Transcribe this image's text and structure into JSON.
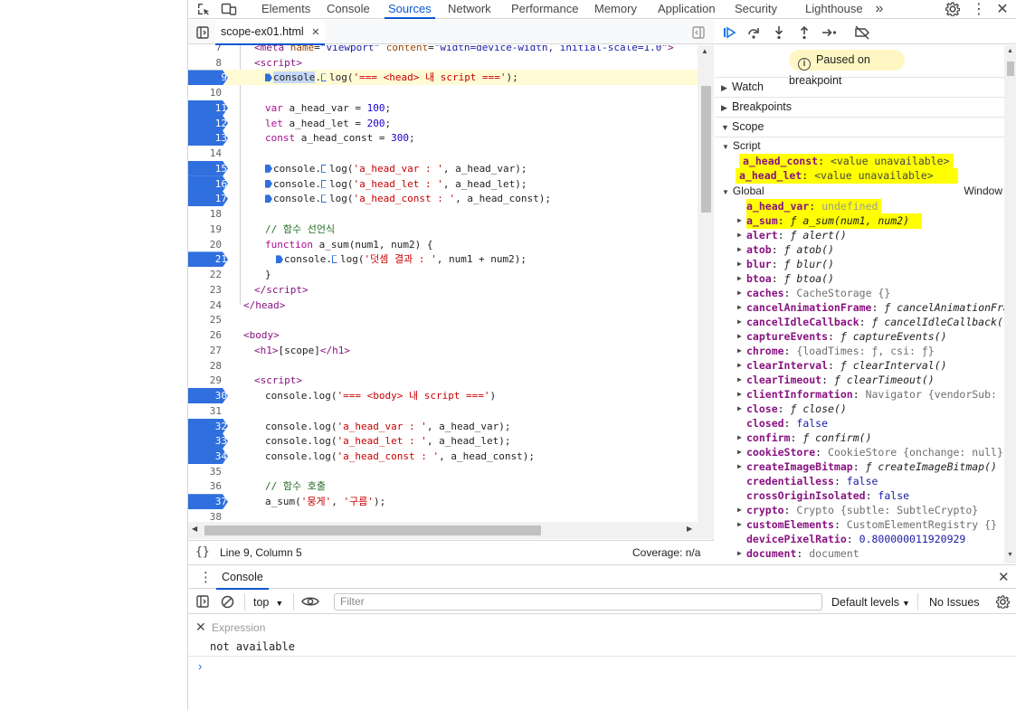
{
  "top_tabs": [
    "Elements",
    "Console",
    "Sources",
    "Network",
    "Performance",
    "Memory",
    "Application",
    "Security",
    "Lighthouse"
  ],
  "active_tab": "Sources",
  "file_tab": {
    "name": "scope-ex01.html"
  },
  "status": {
    "position": "Line 9, Column 5",
    "coverage": "Coverage: n/a"
  },
  "paused_text": "Paused on breakpoint",
  "sections": {
    "watch": "Watch",
    "breakpoints": "Breakpoints",
    "scope": "Scope",
    "script": "Script",
    "global": "Global",
    "global_value": "Window"
  },
  "scope_script": [
    {
      "name": "a_head_const",
      "value": "<value unavailable>"
    },
    {
      "name": "a_head_let",
      "value": "<value unavailable>"
    }
  ],
  "scope_global": [
    {
      "name": "a_head_var",
      "value": "undefined",
      "kind": "plain",
      "hl": true,
      "exp": false
    },
    {
      "name": "a_sum",
      "value": "ƒ a_sum(num1, num2)",
      "kind": "fn",
      "hl": true,
      "exp": true
    },
    {
      "name": "alert",
      "value": "ƒ alert()",
      "kind": "fn",
      "exp": true
    },
    {
      "name": "atob",
      "value": "ƒ atob()",
      "kind": "fn",
      "exp": true
    },
    {
      "name": "blur",
      "value": "ƒ blur()",
      "kind": "fn",
      "exp": true
    },
    {
      "name": "btoa",
      "value": "ƒ btoa()",
      "kind": "fn",
      "exp": true
    },
    {
      "name": "caches",
      "value": "CacheStorage {}",
      "kind": "plain",
      "exp": true
    },
    {
      "name": "cancelAnimationFrame",
      "value": "ƒ cancelAnimationFrame(",
      "kind": "fn",
      "exp": true
    },
    {
      "name": "cancelIdleCallback",
      "value": "ƒ cancelIdleCallback(",
      "kind": "fn",
      "exp": true
    },
    {
      "name": "captureEvents",
      "value": "ƒ captureEvents()",
      "kind": "fn",
      "exp": true
    },
    {
      "name": "chrome",
      "value": "{loadTimes: ƒ, csi: ƒ}",
      "kind": "plain",
      "exp": true
    },
    {
      "name": "clearInterval",
      "value": "ƒ clearInterval()",
      "kind": "fn",
      "exp": true
    },
    {
      "name": "clearTimeout",
      "value": "ƒ clearTimeout()",
      "kind": "fn",
      "exp": true
    },
    {
      "name": "clientInformation",
      "value": "Navigator {vendorSub: '', p",
      "kind": "plain",
      "exp": true
    },
    {
      "name": "close",
      "value": "ƒ close()",
      "kind": "fn",
      "exp": true
    },
    {
      "name": "closed",
      "value": "false",
      "kind": "bool",
      "exp": false
    },
    {
      "name": "confirm",
      "value": "ƒ confirm()",
      "kind": "fn",
      "exp": true
    },
    {
      "name": "cookieStore",
      "value": "CookieStore {onchange: null}",
      "kind": "plain",
      "exp": true
    },
    {
      "name": "createImageBitmap",
      "value": "ƒ createImageBitmap()",
      "kind": "fn",
      "exp": true
    },
    {
      "name": "credentialless",
      "value": "false",
      "kind": "bool",
      "exp": false
    },
    {
      "name": "crossOriginIsolated",
      "value": "false",
      "kind": "bool",
      "exp": false
    },
    {
      "name": "crypto",
      "value": "Crypto {subtle: SubtleCrypto}",
      "kind": "plain",
      "exp": true
    },
    {
      "name": "customElements",
      "value": "CustomElementRegistry {}",
      "kind": "plain",
      "exp": true
    },
    {
      "name": "devicePixelRatio",
      "value": "0.800000011920929",
      "kind": "bool",
      "exp": false
    },
    {
      "name": "document",
      "value": "document",
      "kind": "plain",
      "exp": true
    }
  ],
  "code_lines": [
    {
      "n": 7,
      "html": "<span class=\"tag\">&lt;meta</span> <span class=\"attr\">name</span>=<span class=\"aval\">\"viewport\"</span> <span class=\"attr\">content</span>=<span class=\"aval\">\"width=device-width, initial-scale=1.0\"</span><span class=\"tag\">&gt;</span>",
      "indent": 1
    },
    {
      "n": 8,
      "html": "<span class=\"tag\">&lt;script&gt;</span>",
      "indent": 1
    },
    {
      "n": 9,
      "bp": true,
      "hl": true,
      "html": "<span class=\"bpm\"></span><span class=\"sel\">console</span>.<span class=\"bpo\"></span>log(<span class=\"str\">'=== &lt;head&gt; 내 script ==='</span>);",
      "indent": 2
    },
    {
      "n": 10,
      "html": "",
      "indent": 2
    },
    {
      "n": 11,
      "bp": true,
      "html": "<span class=\"kw\">var</span> a_head_var = <span class=\"num\">100</span>;",
      "indent": 2
    },
    {
      "n": 12,
      "bp": true,
      "html": "<span class=\"kw\">let</span> a_head_let = <span class=\"num\">200</span>;",
      "indent": 2
    },
    {
      "n": 13,
      "bp": true,
      "html": "<span class=\"kw\">const</span> a_head_const = <span class=\"num\">300</span>;",
      "indent": 2
    },
    {
      "n": 14,
      "html": "",
      "indent": 2
    },
    {
      "n": 15,
      "bp": true,
      "html": "<span class=\"bpm\"></span>console.<span class=\"bpo\"></span>log(<span class=\"str\">'a_head_var : '</span>, a_head_var);",
      "indent": 2
    },
    {
      "n": 16,
      "bp": true,
      "html": "<span class=\"bpm\"></span>console.<span class=\"bpo\"></span>log(<span class=\"str\">'a_head_let : '</span>, a_head_let);",
      "indent": 2
    },
    {
      "n": 17,
      "bp": true,
      "html": "<span class=\"bpm\"></span>console.<span class=\"bpo\"></span>log(<span class=\"str\">'a_head_const : '</span>, a_head_const);",
      "indent": 2
    },
    {
      "n": 18,
      "html": "",
      "indent": 2
    },
    {
      "n": 19,
      "html": "<span class=\"cm\">// 함수 선언식</span>",
      "indent": 2
    },
    {
      "n": 20,
      "html": "<span class=\"kw\">function</span> a_sum(num1, num2) {",
      "indent": 2
    },
    {
      "n": 21,
      "bp": true,
      "html": "<span class=\"bpm\"></span>console.<span class=\"bpo\"></span>log(<span class=\"str\">'덧셈 결과 : '</span>, num1 + num2);",
      "indent": 3
    },
    {
      "n": 22,
      "html": "}",
      "indent": 2
    },
    {
      "n": 23,
      "html": "<span class=\"tag\">&lt;/script&gt;</span>",
      "indent": 1
    },
    {
      "n": 24,
      "html": "<span class=\"tag\">&lt;/head&gt;</span>",
      "indent": 0
    },
    {
      "n": 25,
      "html": "",
      "indent": 0
    },
    {
      "n": 26,
      "html": "<span class=\"tag\">&lt;body&gt;</span>",
      "indent": 0
    },
    {
      "n": 27,
      "html": "<span class=\"tag\">&lt;h1&gt;</span>[scope]<span class=\"tag\">&lt;/h1&gt;</span>",
      "indent": 1
    },
    {
      "n": 28,
      "html": "",
      "indent": 1
    },
    {
      "n": 29,
      "html": "<span class=\"tag\">&lt;script&gt;</span>",
      "indent": 1
    },
    {
      "n": 30,
      "bp": true,
      "html": "console.log(<span class=\"str\">'=== &lt;body&gt; 내 script ==='</span>)",
      "indent": 2
    },
    {
      "n": 31,
      "html": "",
      "indent": 2
    },
    {
      "n": 32,
      "bp": true,
      "html": "console.log(<span class=\"str\">'a_head_var : '</span>, a_head_var);",
      "indent": 2
    },
    {
      "n": 33,
      "bp": true,
      "html": "console.log(<span class=\"str\">'a_head_let : '</span>, a_head_let);",
      "indent": 2
    },
    {
      "n": 34,
      "bp": true,
      "html": "console.log(<span class=\"str\">'a_head_const : '</span>, a_head_const);",
      "indent": 2
    },
    {
      "n": 35,
      "html": "",
      "indent": 2
    },
    {
      "n": 36,
      "html": "<span class=\"cm\">// 함수 호출</span>",
      "indent": 2
    },
    {
      "n": 37,
      "bp": true,
      "html": "a_sum(<span class=\"str\">'뭉게'</span>, <span class=\"str\">'구름'</span>);",
      "indent": 2
    },
    {
      "n": 38,
      "html": "",
      "indent": 2
    }
  ],
  "drawer": {
    "tab": "Console",
    "context": "top",
    "filter_placeholder": "Filter",
    "levels": "Default levels",
    "issues": "No Issues",
    "expression_placeholder": "Expression",
    "expression_result": "not available"
  }
}
